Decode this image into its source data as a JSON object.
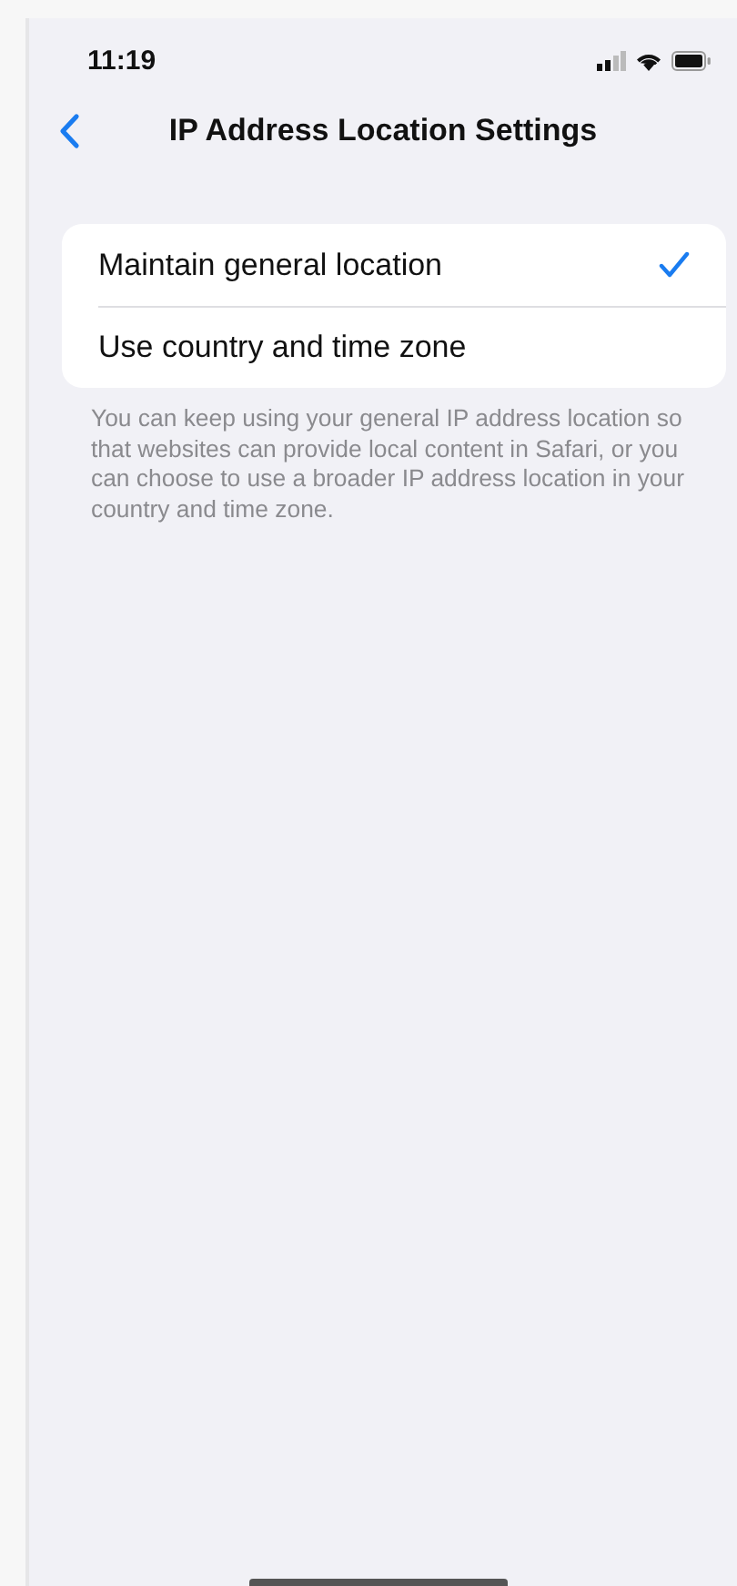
{
  "status_bar": {
    "time": "11:19"
  },
  "nav_bar": {
    "title": "IP Address Location Settings"
  },
  "options": [
    {
      "label": "Maintain general location",
      "selected": true
    },
    {
      "label": "Use country and time zone",
      "selected": false
    }
  ],
  "footer": "You can keep using your general IP address location so that websites can provide local content in Safari, or you can choose to use a broader IP address location in your country and time zone."
}
